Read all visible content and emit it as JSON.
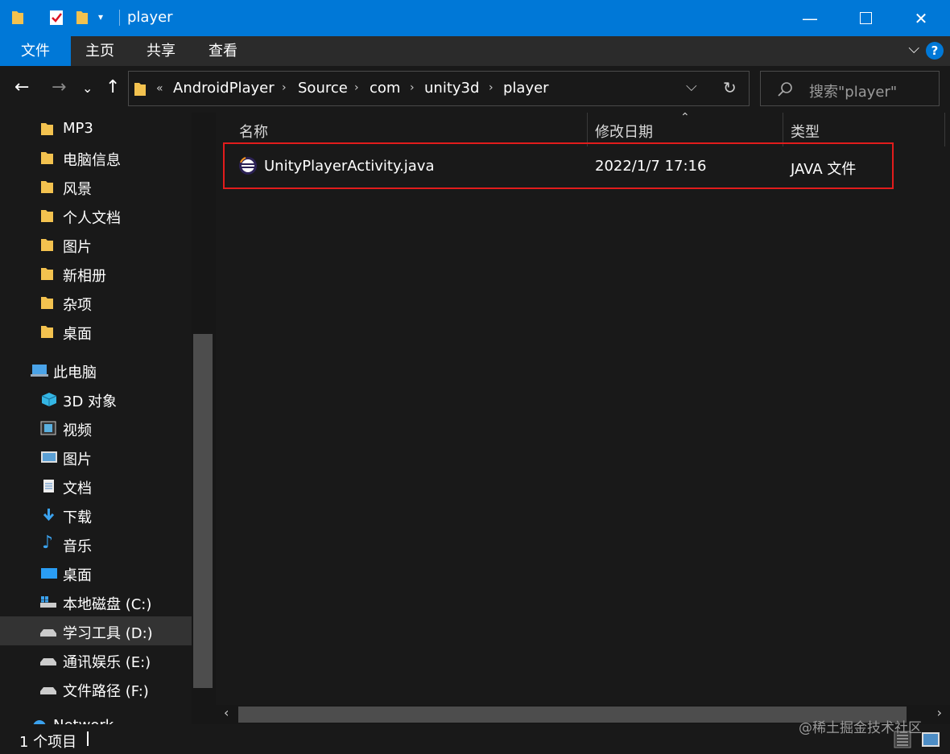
{
  "window": {
    "title": "player"
  },
  "ribbon": {
    "tabs": [
      "文件",
      "主页",
      "共享",
      "查看"
    ]
  },
  "address": {
    "overflow": "«",
    "crumbs": [
      "AndroidPlayer",
      "Source",
      "com",
      "unity3d",
      "player"
    ]
  },
  "search": {
    "placeholder": "搜索\"player\""
  },
  "sidebar": {
    "quick_access": [
      "MP3",
      "电脑信息",
      "风景",
      "个人文档",
      "图片",
      "新相册",
      "杂项",
      "桌面"
    ],
    "this_pc": {
      "label": "此电脑"
    },
    "pc_items": [
      "3D 对象",
      "视频",
      "图片",
      "文档",
      "下载",
      "音乐",
      "桌面",
      "本地磁盘 (C:)",
      "学习工具 (D:)",
      "通讯娱乐 (E:)",
      "文件路径 (F:)"
    ],
    "network": "Network",
    "selected": "学习工具 (D:)"
  },
  "columns": {
    "name": "名称",
    "modified": "修改日期",
    "type": "类型"
  },
  "files": [
    {
      "name": "UnityPlayerActivity.java",
      "modified": "2022/1/7 17:16",
      "type": "JAVA 文件"
    }
  ],
  "status": {
    "count": "1 个项目"
  },
  "watermark": "@稀土掘金技术社区",
  "colors": {
    "accent": "#0078d7",
    "highlight": "#e21c1c",
    "folder": "#e9b949"
  }
}
